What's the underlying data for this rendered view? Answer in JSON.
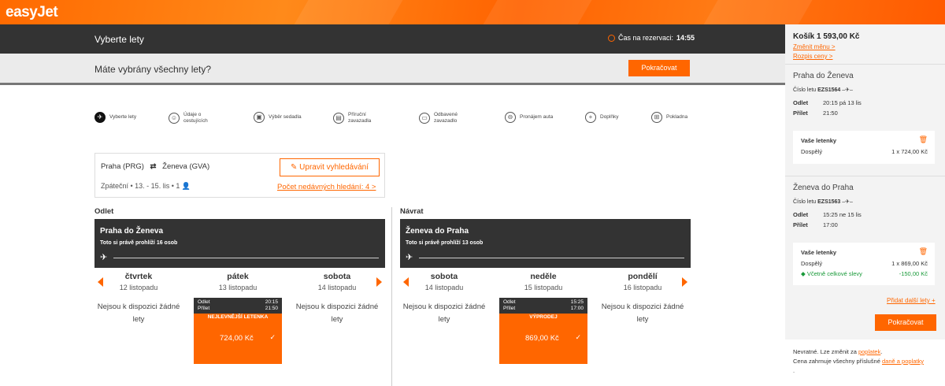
{
  "brand": {
    "logo": "easyJet",
    "accent": "#ff6600"
  },
  "header": {
    "title": "Vyberte lety",
    "timer_label": "Čas na rezervaci:",
    "timer_value": "14:55"
  },
  "prompt": {
    "question": "Máte vybrány všechny lety?",
    "continue": "Pokračovat"
  },
  "steps": [
    {
      "label": "Vyberte lety",
      "icon": "plane-icon"
    },
    {
      "label": "Údaje o cestujících",
      "icon": "person-icon"
    },
    {
      "label": "Výběr sedadla",
      "icon": "seat-icon"
    },
    {
      "label": "Příruční zavazadla",
      "icon": "bag-icon"
    },
    {
      "label": "Odbavené zavazadlo",
      "icon": "suitcase-icon"
    },
    {
      "label": "Pronájem auta",
      "icon": "car-icon"
    },
    {
      "label": "Doplňky",
      "icon": "plus-icon"
    },
    {
      "label": "Pokladna",
      "icon": "cart-icon"
    }
  ],
  "search": {
    "from": "Praha (PRG)",
    "to": "Ženeva (GVA)",
    "meta": "Zpáteční • 13. - 15. lis • 1",
    "edit": "Upravit vyhledávání",
    "recent": "Počet nedávných hledání: 4 >"
  },
  "outbound": {
    "label": "Odlet",
    "route": "Praha do Ženeva",
    "viewers": "Toto si právě prohlíží 16 osob",
    "days": [
      {
        "name": "čtvrtek",
        "date": "12 listopadu",
        "na": "Nejsou k dispozici žádné lety"
      },
      {
        "name": "pátek",
        "date": "13 listopadu"
      },
      {
        "name": "sobota",
        "date": "14 listopadu",
        "na": "Nejsou k dispozici žádné lety"
      }
    ],
    "card": {
      "dep_label": "Odlet",
      "dep": "20:15",
      "arr_label": "Přílet",
      "arr": "21:50",
      "tag": "NEJLEVNĚJŠÍ LETENKA",
      "price": "724,00 Kč"
    }
  },
  "inbound": {
    "label": "Návrat",
    "route": "Ženeva do Praha",
    "viewers": "Toto si právě prohlíží 13 osob",
    "days": [
      {
        "name": "sobota",
        "date": "14 listopadu",
        "na": "Nejsou k dispozici žádné lety"
      },
      {
        "name": "neděle",
        "date": "15 listopadu"
      },
      {
        "name": "pondělí",
        "date": "16 listopadu",
        "na": "Nejsou k dispozici žádné lety"
      }
    ],
    "card": {
      "dep_label": "Odlet",
      "dep": "15:25",
      "arr_label": "Přílet",
      "arr": "17:00",
      "tag": "VÝPRODEJ",
      "price": "869,00 Kč"
    }
  },
  "basket": {
    "total": "Košík 1 593,00 Kč",
    "change_currency": "Změnit měnu >",
    "breakdown": "Rozpis ceny >",
    "legs": [
      {
        "title": "Praha do Ženeva",
        "flight_label": "Číslo letu",
        "flight": "EZS1564",
        "dep_label": "Odlet",
        "dep": "20:15 pá 13 lis",
        "arr_label": "Přílet",
        "arr": "21:50",
        "tickets": "Vaše letenky",
        "pax": "Dospělý",
        "price": "1 x 724,00 Kč"
      },
      {
        "title": "Ženeva do Praha",
        "flight_label": "Číslo letu",
        "flight": "EZS1563",
        "dep_label": "Odlet",
        "dep": "15:25 ne 15 lis",
        "arr_label": "Přílet",
        "arr": "17:00",
        "tickets": "Vaše letenky",
        "pax": "Dospělý",
        "price": "1 x 869,00 Kč",
        "discount_label": "Včetně celkové slevy",
        "discount": "-150,00 Kč"
      }
    ],
    "add_flight": "Přidat další lety",
    "continue": "Pokračovat",
    "footer_1": "Nevratné. Lze změnit za",
    "footer_1_link": "poplatek",
    "footer_2": "Cena zahrnuje všechny příslušné",
    "footer_2_link": "daně a poplatky"
  }
}
